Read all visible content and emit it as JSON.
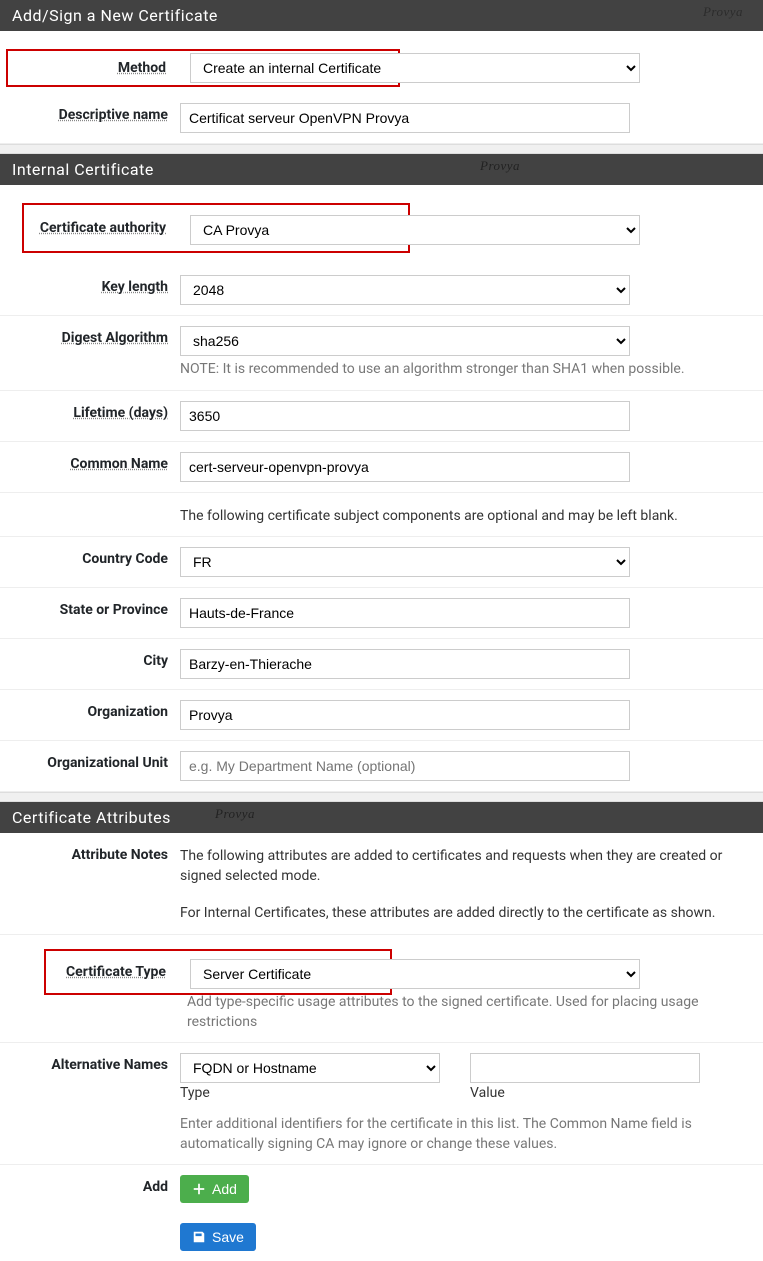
{
  "section1": {
    "title": "Add/Sign a New Certificate",
    "method_label": "Method",
    "method_value": "Create an internal Certificate",
    "name_label": "Descriptive name",
    "name_value": "Certificat serveur OpenVPN Provya"
  },
  "section2": {
    "title": "Internal Certificate",
    "ca_label": "Certificate authority",
    "ca_value": "CA Provya",
    "keylen_label": "Key length",
    "keylen_value": "2048",
    "digest_label": "Digest Algorithm",
    "digest_value": "sha256",
    "digest_note": "NOTE: It is recommended to use an algorithm stronger than SHA1 when possible.",
    "lifetime_label": "Lifetime (days)",
    "lifetime_value": "3650",
    "cn_label": "Common Name",
    "cn_value": "cert-serveur-openvpn-provya",
    "optional_note": "The following certificate subject components are optional and may be left blank.",
    "country_label": "Country Code",
    "country_value": "FR",
    "state_label": "State or Province",
    "state_value": "Hauts-de-France",
    "city_label": "City",
    "city_value": "Barzy-en-Thierache",
    "org_label": "Organization",
    "org_value": "Provya",
    "ou_label": "Organizational Unit",
    "ou_placeholder": "e.g. My Department Name (optional)"
  },
  "section3": {
    "title": "Certificate Attributes",
    "attr_notes_label": "Attribute Notes",
    "attr_notes_1": "The following attributes are added to certificates and requests when they are created or signed selected mode.",
    "attr_notes_2": "For Internal Certificates, these attributes are added directly to the certificate as shown.",
    "cert_type_label": "Certificate Type",
    "cert_type_value": "Server Certificate",
    "cert_type_help": "Add type-specific usage attributes to the signed certificate. Used for placing usage restrictions",
    "altnames_label": "Alternative Names",
    "altnames_type_value": "FQDN or Hostname",
    "altnames_type_sub": "Type",
    "altnames_value_sub": "Value",
    "altnames_help": "Enter additional identifiers for the certificate in this list. The Common Name field is automatically signing CA may ignore or change these values.",
    "add_label": "Add",
    "add_btn": "Add",
    "save_btn": "Save"
  },
  "watermark": "Provya"
}
